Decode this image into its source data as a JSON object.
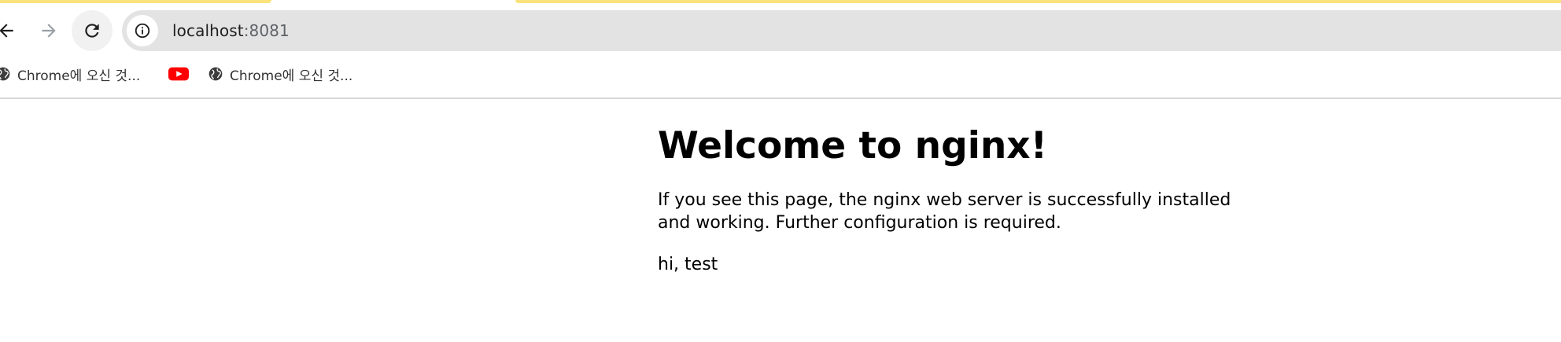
{
  "browser": {
    "address_bar": {
      "host": "localhost",
      "port": ":8081"
    },
    "icons": {
      "back": "back-arrow-icon",
      "forward": "forward-arrow-icon",
      "reload": "reload-icon",
      "site_info": "info-icon"
    },
    "bookmarks": [
      {
        "label": "Chrome에 오신 것...",
        "icon": "globe-icon"
      },
      {
        "label": "",
        "icon": "youtube-icon"
      },
      {
        "label": "Chrome에 오신 것...",
        "icon": "globe-icon"
      }
    ],
    "colors": {
      "tab_accent": "#fce27a",
      "omnibox_bg": "#e3e3e3",
      "youtube_red": "#ff0000"
    }
  },
  "page": {
    "heading": "Welcome to nginx!",
    "paragraph_1": "If you see this page, the nginx web server is successfully installed and working. Further configuration is required.",
    "paragraph_2": "hi, test"
  }
}
